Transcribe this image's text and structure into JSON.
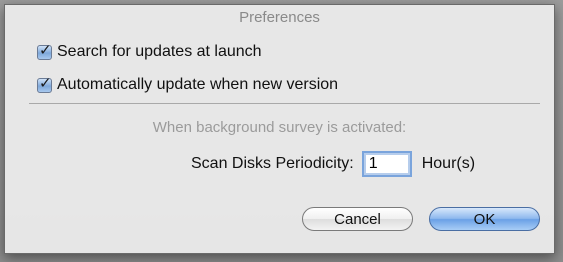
{
  "window": {
    "title": "Preferences"
  },
  "options": [
    {
      "label": "Search for updates at launch",
      "checked": true
    },
    {
      "label": "Automatically update when new version",
      "checked": true
    }
  ],
  "survey": {
    "note": "When background survey is activated:",
    "scan_label": "Scan Disks Periodicity:",
    "scan_value": "1",
    "scan_unit": "Hour(s)"
  },
  "buttons": {
    "cancel_label": "Cancel",
    "ok_label": "OK"
  },
  "colors": {
    "accent": "#7aa4dc",
    "ok_button": "#6aa0e6"
  },
  "icons": {
    "checkmark": "checkmark-icon"
  }
}
